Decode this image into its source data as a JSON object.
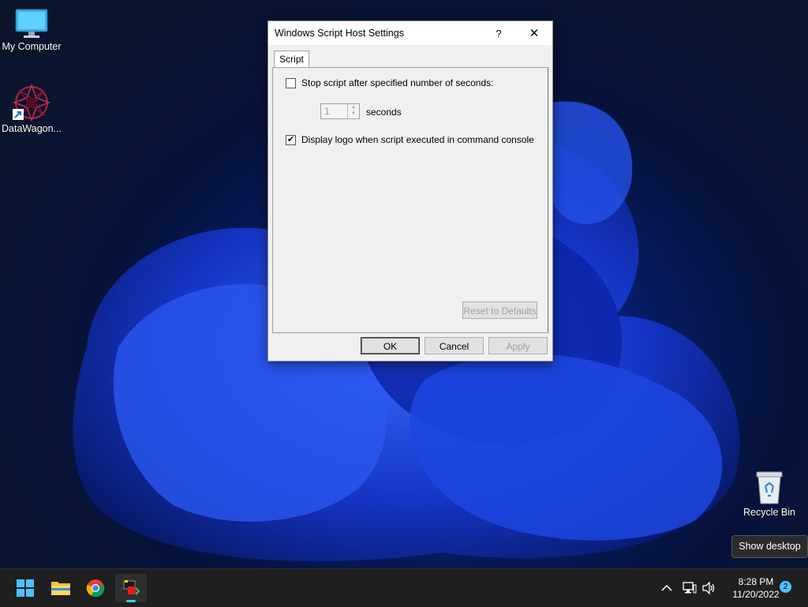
{
  "desktop": {
    "icons": [
      {
        "label": "My Computer"
      },
      {
        "label": "DataWagon..."
      },
      {
        "label": "Recycle Bin"
      }
    ],
    "tooltip": "Show desktop"
  },
  "dialog": {
    "title": "Windows Script Host Settings",
    "help_label": "?",
    "close_label": "✕",
    "tab_label": "Script",
    "stop_script": {
      "label": "Stop script after specified number of seconds:",
      "checked": false
    },
    "seconds": {
      "value": "1",
      "unit_label": "seconds"
    },
    "display_logo": {
      "label": "Display logo when script executed in command console",
      "checked": true
    },
    "reset_label": "Reset to Defaults",
    "ok_label": "OK",
    "cancel_label": "Cancel",
    "apply_label": "Apply"
  },
  "taskbar": {
    "apps": [
      "start-icon",
      "file-explorer-icon",
      "chrome-icon",
      "script-host-icon"
    ],
    "time": "8:28 PM",
    "date": "11/20/2022",
    "notification_count": "2"
  },
  "colors": {
    "accent": "#4cc2ff",
    "taskbar": "#1f1f1f",
    "dialog_bg": "#f0f0f0"
  }
}
